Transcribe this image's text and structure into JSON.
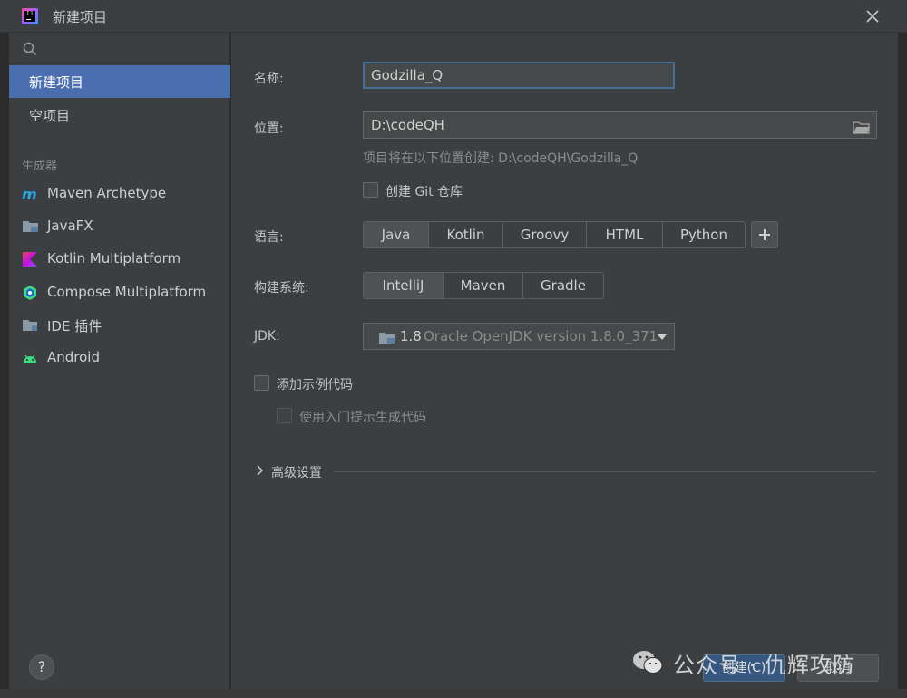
{
  "window": {
    "title": "新建项目"
  },
  "sidebar": {
    "search_placeholder": "",
    "top_items": [
      {
        "label": "新建项目",
        "selected": true
      },
      {
        "label": "空项目",
        "selected": false
      }
    ],
    "section_label": "生成器",
    "generators": [
      {
        "label": "Maven Archetype",
        "icon": "maven-icon"
      },
      {
        "label": "JavaFX",
        "icon": "folder-icon"
      },
      {
        "label": "Kotlin Multiplatform",
        "icon": "kotlin-icon"
      },
      {
        "label": "Compose Multiplatform",
        "icon": "compose-icon"
      },
      {
        "label": "IDE 插件",
        "icon": "plugin-icon"
      },
      {
        "label": "Android",
        "icon": "android-icon"
      }
    ],
    "help_label": "?"
  },
  "form": {
    "name_label": "名称:",
    "name_value": "Godzilla_Q",
    "location_label": "位置:",
    "location_value": "D:\\codeQH",
    "location_hint": "项目将在以下位置创建: D:\\codeQH\\Godzilla_Q",
    "git_checkbox_label": "创建 Git 仓库",
    "language_label": "语言:",
    "languages": [
      "Java",
      "Kotlin",
      "Groovy",
      "HTML",
      "Python"
    ],
    "language_selected": "Java",
    "build_label": "构建系统:",
    "build_systems": [
      "IntelliJ",
      "Maven",
      "Gradle"
    ],
    "build_selected": "IntelliJ",
    "jdk_label": "JDK:",
    "jdk_version": "1.8",
    "jdk_name": "Oracle OpenJDK version 1.8.0_371",
    "sample_code_label": "添加示例代码",
    "onboarding_label": "使用入门提示生成代码",
    "advanced_label": "高级设置"
  },
  "buttons": {
    "create": "创建(C)",
    "cancel": "取消"
  },
  "watermark": {
    "text": "公众号 · 仇辉攻防"
  },
  "colors": {
    "selected_bg": "#4b6eaf",
    "panel_bg": "#3c3f41",
    "focus_border": "#466d94",
    "primary_button": "#365880"
  }
}
